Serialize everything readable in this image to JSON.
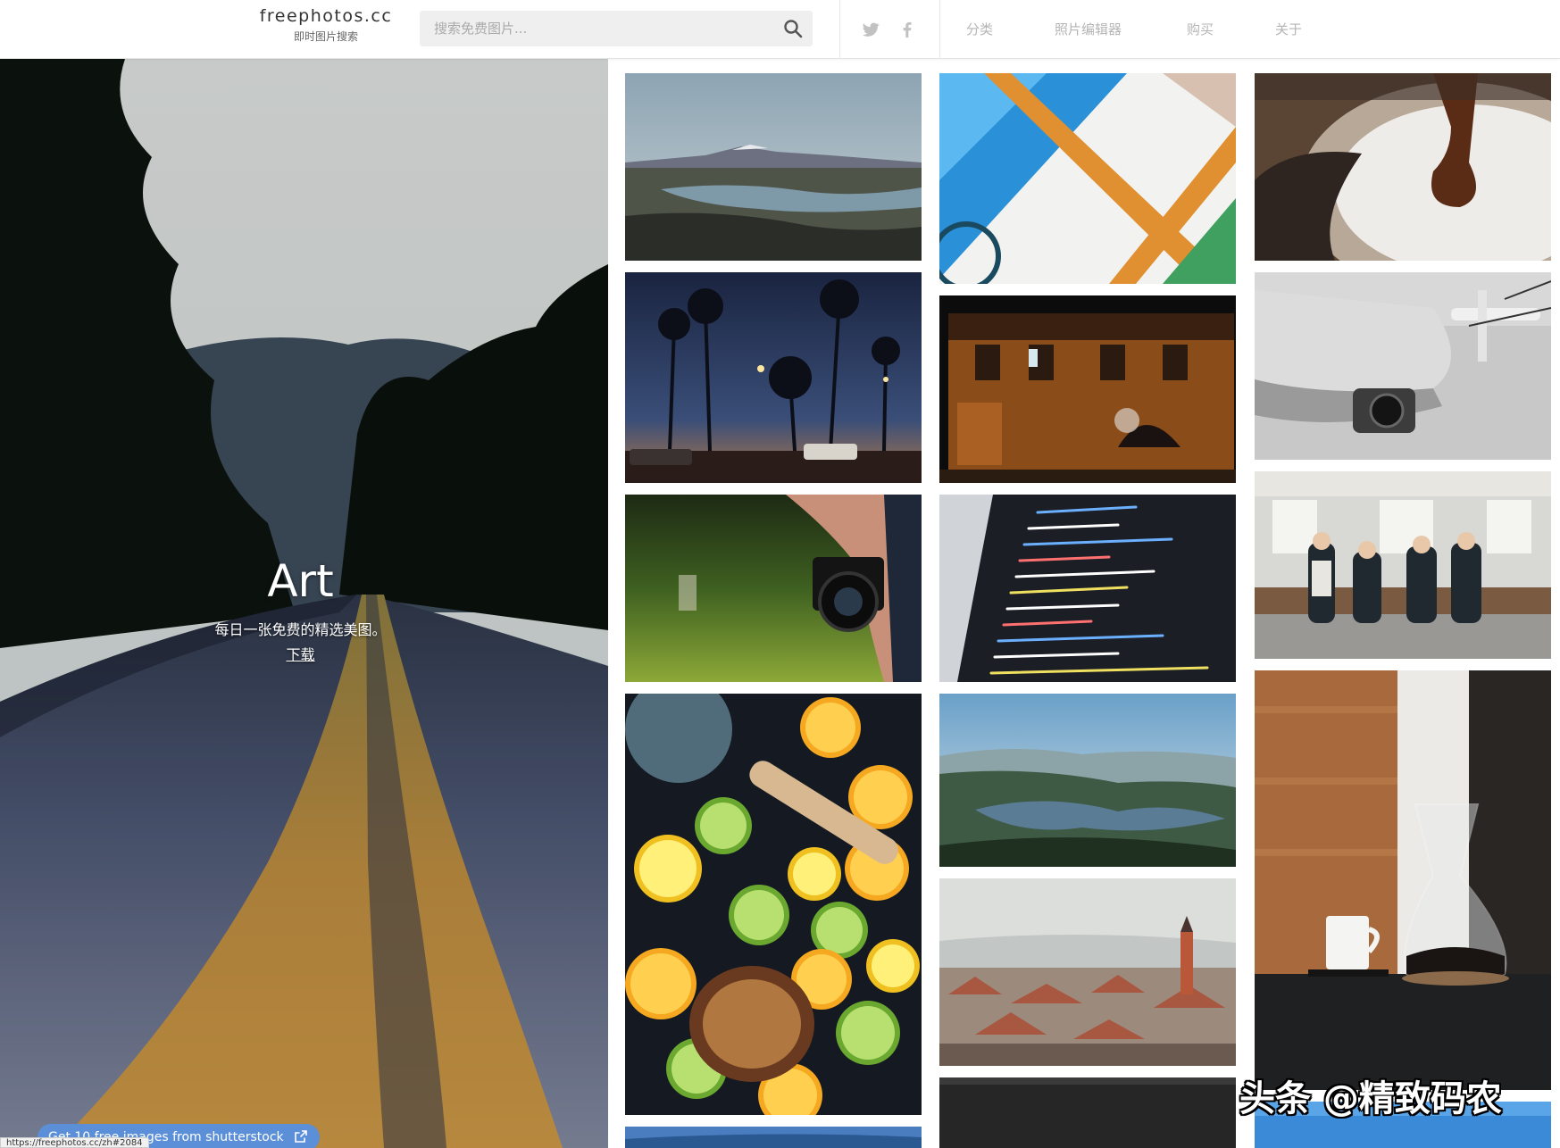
{
  "header": {
    "logo_name": "freephotos.cc",
    "logo_tagline": "即时图片搜索",
    "search_placeholder": "搜索免费图片...",
    "nav": [
      {
        "label": "分类"
      },
      {
        "label": "照片编辑器"
      },
      {
        "label": "购买"
      },
      {
        "label": "关于"
      }
    ],
    "social": [
      "twitter-icon",
      "facebook-icon"
    ]
  },
  "hero": {
    "title": "Art",
    "subtitle": "每日一张免费的精选美图。",
    "download_label": "下载"
  },
  "promo": {
    "label": "Get 10 free images from shutterstock",
    "icon": "external-link-icon",
    "accent": "#5b8fd8"
  },
  "status_url": "https://freephotos.cc/zh#2084",
  "watermark": "头条 @精致码农",
  "gallery": {
    "columns": 3,
    "tiles": [
      {
        "name": "photo-mountain-lake-landscape"
      },
      {
        "name": "photo-palm-trees-night-street"
      },
      {
        "name": "photo-hand-holding-camera"
      },
      {
        "name": "photo-citrus-fruits-flatlay"
      },
      {
        "name": "photo-ocean-coast-partial"
      },
      {
        "name": "photo-colorful-abstract-frames"
      },
      {
        "name": "photo-painted-building-night"
      },
      {
        "name": "photo-code-on-screen"
      },
      {
        "name": "photo-lake-hills-aerial"
      },
      {
        "name": "photo-old-town-rooftops"
      },
      {
        "name": "photo-dark-partial"
      },
      {
        "name": "photo-chocolate-pouring"
      },
      {
        "name": "photo-drone-closeup"
      },
      {
        "name": "photo-subway-passengers"
      },
      {
        "name": "photo-coffee-maker-table"
      },
      {
        "name": "photo-blue-sky-partial"
      }
    ]
  }
}
